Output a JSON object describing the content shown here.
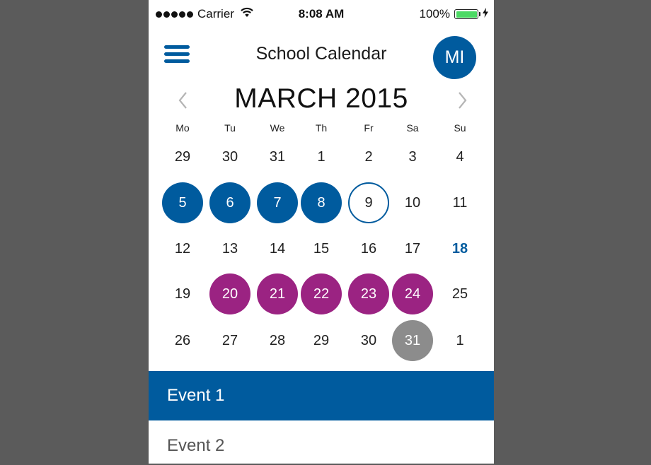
{
  "status_bar": {
    "carrier": "Carrier",
    "time": "8:08 AM",
    "battery_percent": "100%",
    "battery_level": 1.0
  },
  "header": {
    "title": "School Calendar",
    "avatar_initials": "MI",
    "menu_icon": "hamburger-menu-icon"
  },
  "calendar": {
    "month_label": "MARCH 2015",
    "prev_icon": "chevron-left-icon",
    "next_icon": "chevron-right-icon",
    "weekdays": [
      "Mo",
      "Tu",
      "We",
      "Th",
      "Fr",
      "Sa",
      "Su"
    ],
    "weeks": [
      [
        {
          "label": "29",
          "style": "plain"
        },
        {
          "label": "30",
          "style": "plain"
        },
        {
          "label": "31",
          "style": "plain"
        },
        {
          "label": "1",
          "style": "plain"
        },
        {
          "label": "2",
          "style": "plain"
        },
        {
          "label": "3",
          "style": "plain"
        },
        {
          "label": "4",
          "style": "plain"
        }
      ],
      [
        {
          "label": "5",
          "style": "sel-blue"
        },
        {
          "label": "6",
          "style": "sel-blue"
        },
        {
          "label": "7",
          "style": "sel-blue"
        },
        {
          "label": "8",
          "style": "sel-blue"
        },
        {
          "label": "9",
          "style": "today-ring"
        },
        {
          "label": "10",
          "style": "plain"
        },
        {
          "label": "11",
          "style": "plain"
        }
      ],
      [
        {
          "label": "12",
          "style": "plain"
        },
        {
          "label": "13",
          "style": "plain"
        },
        {
          "label": "14",
          "style": "plain"
        },
        {
          "label": "15",
          "style": "plain"
        },
        {
          "label": "16",
          "style": "plain"
        },
        {
          "label": "17",
          "style": "plain"
        },
        {
          "label": "18",
          "style": "highlight-blue"
        }
      ],
      [
        {
          "label": "19",
          "style": "plain"
        },
        {
          "label": "20",
          "style": "sel-purple"
        },
        {
          "label": "21",
          "style": "sel-purple"
        },
        {
          "label": "22",
          "style": "sel-purple"
        },
        {
          "label": "23",
          "style": "sel-purple"
        },
        {
          "label": "24",
          "style": "sel-purple"
        },
        {
          "label": "25",
          "style": "plain"
        }
      ],
      [
        {
          "label": "26",
          "style": "plain"
        },
        {
          "label": "27",
          "style": "plain"
        },
        {
          "label": "28",
          "style": "plain"
        },
        {
          "label": "29",
          "style": "plain"
        },
        {
          "label": "30",
          "style": "plain"
        },
        {
          "label": "31",
          "style": "sel-grey"
        },
        {
          "label": "1",
          "style": "plain"
        }
      ]
    ]
  },
  "events": [
    {
      "label": "Event 1",
      "active": true
    },
    {
      "label": "Event 2",
      "active": false
    }
  ],
  "colors": {
    "primary_blue": "#005b9e",
    "purple": "#9b2382",
    "grey": "#8c8c8c",
    "battery_green": "#4cd964",
    "outer_background": "#5b5b5b"
  }
}
